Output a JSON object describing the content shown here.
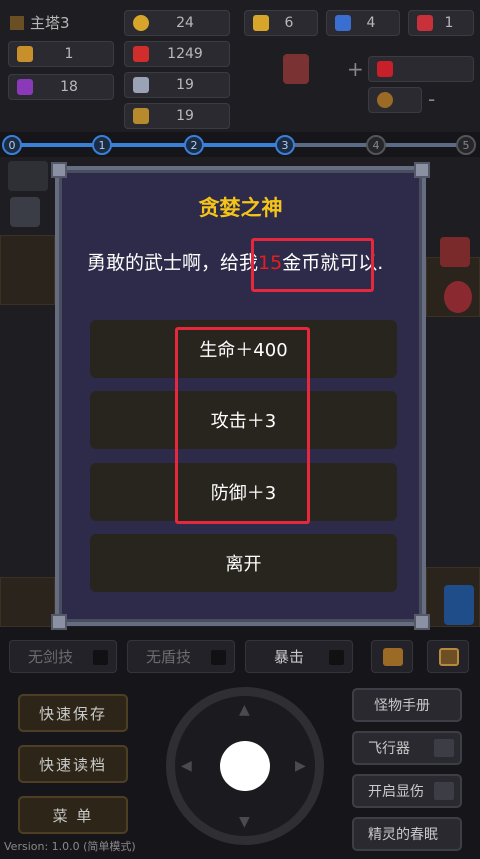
{
  "hud": {
    "floor": "主塔3",
    "level": "1",
    "exp": "18",
    "gold": "24",
    "hp": "1249",
    "atk": "19",
    "def": "19",
    "yellow_keys": "6",
    "blue_keys": "4",
    "red_keys": "1",
    "plus_symbol": "+",
    "minus_symbol": "-"
  },
  "track": {
    "nodes": [
      "0",
      "1",
      "2",
      "3",
      "4",
      "5"
    ]
  },
  "dialog": {
    "npc_name": "贪婪之神",
    "text_before": "勇敢的武士啊，给我",
    "text_highlight": "15",
    "text_after": "金币就可以.",
    "options": [
      "生命＋400",
      "攻击＋3",
      "防御＋3",
      "离开"
    ]
  },
  "skills": {
    "sword": "无剑技",
    "shield": "无盾技",
    "crit": "暴击"
  },
  "left_menu": {
    "quick_save": "快速保存",
    "quick_load": "快速读档",
    "menu": "菜 单"
  },
  "right_menu": {
    "monster_book": "怪物手册",
    "fly": "飞行器",
    "show_toggle": "开启显伤",
    "spring": "精灵的春眠"
  },
  "version": "Version: 1.0.0 (简单模式)",
  "colors": {
    "title_gold": "#f4c419",
    "highlight_red": "#e51e1e",
    "annotation_red": "#e5283b",
    "dialog_bg": "#2e2b4a",
    "track_blue": "#3b80d8"
  },
  "icons": [
    "gold-coin-icon",
    "yellow-key-icon",
    "blue-key-icon",
    "red-key-icon",
    "crown-icon",
    "heart-icon",
    "exp-gem-icon",
    "sword-icon",
    "shield-icon",
    "joystick-knob"
  ]
}
